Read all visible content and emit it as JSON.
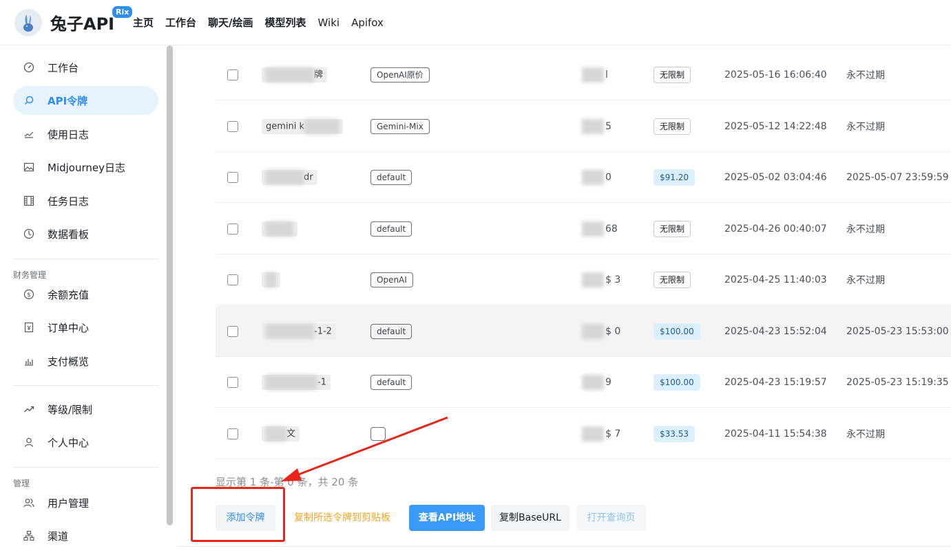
{
  "header": {
    "brand": "兔子API",
    "badge": "Rix",
    "nav": [
      "主页",
      "工作台",
      "聊天/绘画",
      "模型列表",
      "Wiki",
      "Apifox"
    ]
  },
  "sidebar": {
    "items": [
      {
        "label": "工作台",
        "icon": "dashboard-icon"
      },
      {
        "label": "API令牌",
        "icon": "search-icon",
        "active": true
      },
      {
        "label": "使用日志",
        "icon": "log-icon"
      },
      {
        "label": "Midjourney日志",
        "icon": "image-icon"
      },
      {
        "label": "任务日志",
        "icon": "film-icon"
      },
      {
        "label": "数据看板",
        "icon": "clock-pie-icon"
      }
    ],
    "group_finance": "财务管理",
    "finance_items": [
      {
        "label": "余额充值",
        "icon": "dollar-icon"
      },
      {
        "label": "订单中心",
        "icon": "receipt-icon"
      },
      {
        "label": "支付概览",
        "icon": "bar-chart-icon"
      }
    ],
    "personal_items": [
      {
        "label": "等级/限制",
        "icon": "trend-icon"
      },
      {
        "label": "个人中心",
        "icon": "user-icon"
      }
    ],
    "group_admin": "管理",
    "admin_items": [
      {
        "label": "用户管理",
        "icon": "users-icon"
      },
      {
        "label": "渠道",
        "icon": "sitemap-icon"
      }
    ]
  },
  "tokens": [
    {
      "name": "牌",
      "group": "OpenAI原价",
      "used": "l",
      "quota": "无限制",
      "quota_money": false,
      "created": "2025-05-16 16:06:40",
      "expires": "永不过期"
    },
    {
      "name": "gemini k",
      "group": "Gemini-Mix",
      "used": "5",
      "quota": "无限制",
      "quota_money": false,
      "created": "2025-05-12 14:22:48",
      "expires": "永不过期"
    },
    {
      "name": "dr",
      "group": "default",
      "used": "0",
      "quota": "$91.20",
      "quota_money": true,
      "created": "2025-05-02 03:04:46",
      "expires": "2025-05-07 23:59:59"
    },
    {
      "name": "",
      "group": "default",
      "used": "68",
      "quota": "无限制",
      "quota_money": false,
      "created": "2025-04-26 00:40:07",
      "expires": "永不过期"
    },
    {
      "name": "",
      "group": "OpenAI",
      "used": "$ 3",
      "quota": "无限制",
      "quota_money": false,
      "created": "2025-04-25 11:40:03",
      "expires": "永不过期"
    },
    {
      "name": "-1-2",
      "group": "default",
      "used": "$ 0",
      "quota": "$100.00",
      "quota_money": true,
      "created": "2025-04-23 15:52:04",
      "expires": "2025-05-23 15:53:00"
    },
    {
      "name": "-1",
      "group": "default",
      "used": "9",
      "quota": "$100.00",
      "quota_money": true,
      "created": "2025-04-23 15:19:57",
      "expires": "2025-05-23 15:19:35"
    },
    {
      "name": "文",
      "group": "",
      "used": "$ 7",
      "quota": "$33.53",
      "quota_money": true,
      "created": "2025-04-11 15:54:38",
      "expires": "永不过期"
    }
  ],
  "footer": {
    "summary": "显示第 1 条-第 0 条，共 20 条"
  },
  "actions": {
    "add": "添加令牌",
    "copy_selected": "复制所选令牌到剪贴板",
    "view_api": "查看API地址",
    "copy_base": "复制BaseURL",
    "open_query": "打开查询页"
  },
  "colors": {
    "accent": "#2f8ef4",
    "annotation": "#e8261a",
    "money_tag": "#dceffd"
  }
}
